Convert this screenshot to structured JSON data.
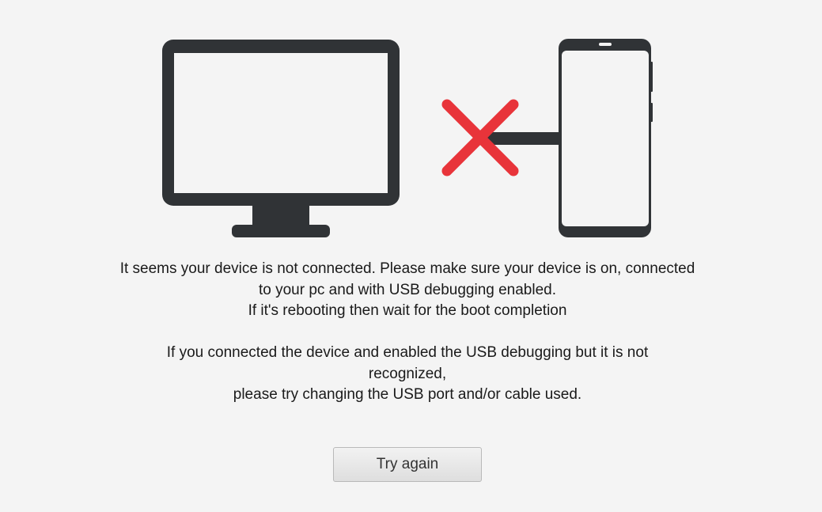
{
  "colors": {
    "background": "#f4f4f4",
    "device_icon": "#303336",
    "device_screen": "#f4f4f4",
    "error_x": "#e8343a"
  },
  "icons": [
    "monitor-icon",
    "disconnected-x-icon",
    "usb-cable-icon",
    "smartphone-icon"
  ],
  "message": {
    "lines": [
      "It seems your device is not connected. Please make sure your device is on, connected",
      "to your pc and with USB debugging enabled.",
      "If it's rebooting then wait for the boot completion"
    ]
  },
  "hint": {
    "lines": [
      "If you connected the device and enabled the USB debugging but it is not",
      "recognized,",
      "please try changing the USB port and/or cable used."
    ]
  },
  "actions": {
    "retry_label": "Try again"
  }
}
